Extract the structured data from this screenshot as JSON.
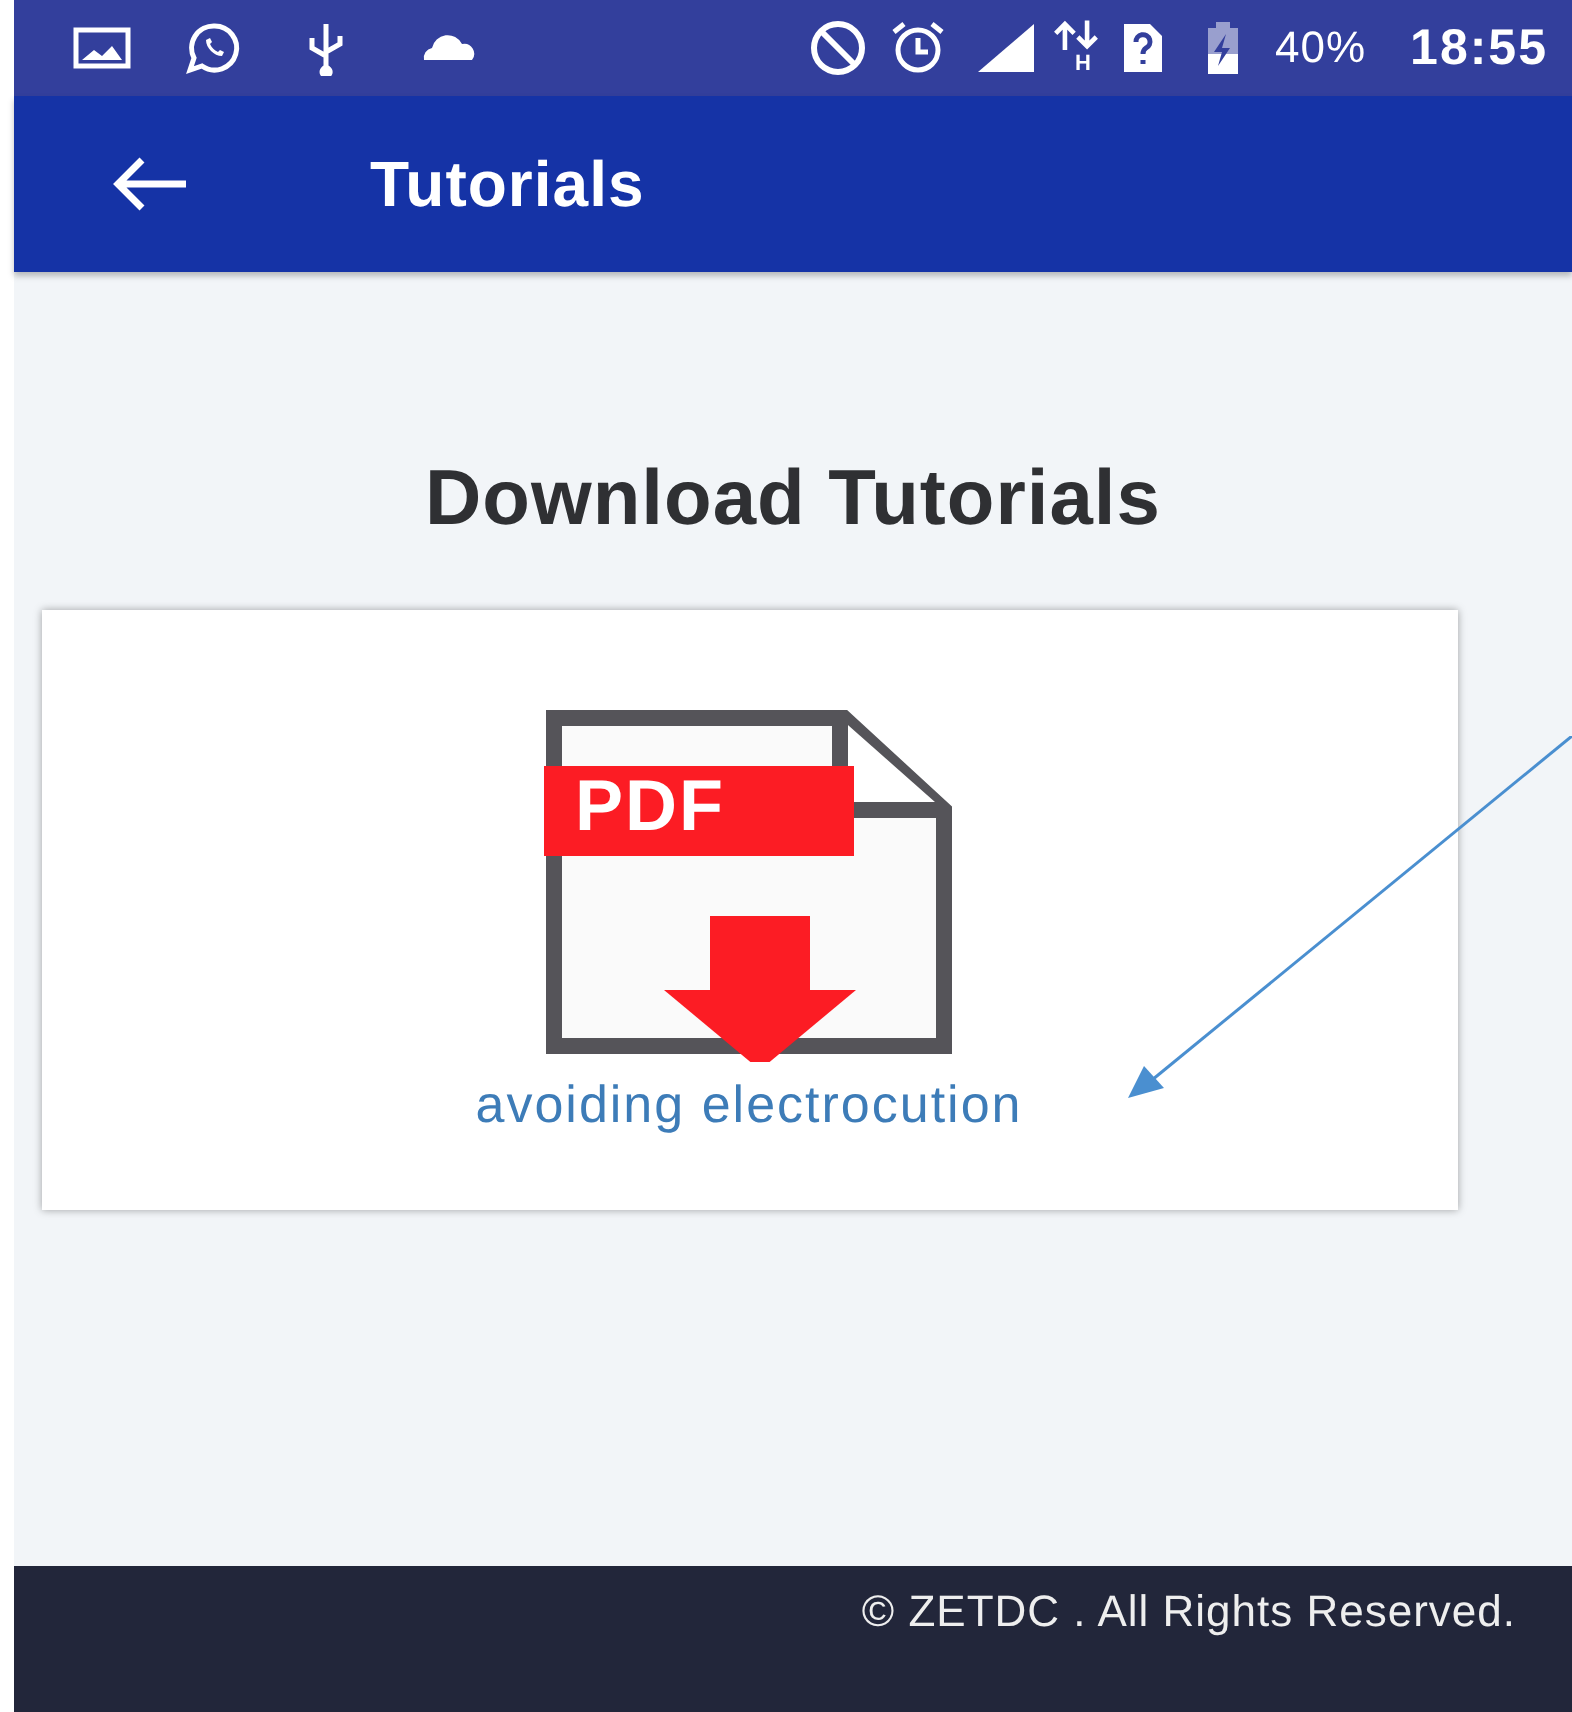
{
  "status_bar": {
    "network_type": "H",
    "battery": "40%",
    "time": "18:55"
  },
  "app_bar": {
    "title": "Tutorials"
  },
  "heading": "Download Tutorials",
  "tutorials": [
    {
      "icon_label": "PDF",
      "title": "avoiding electrocution"
    }
  ],
  "footer": "© ZETDC . All Rights Reserved."
}
